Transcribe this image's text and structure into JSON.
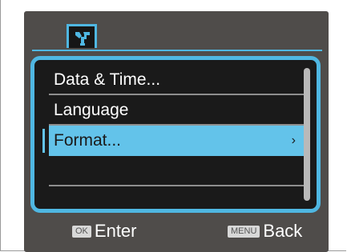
{
  "menu": {
    "tab_icon": "wrench-icon",
    "items": [
      {
        "label": "Data & Time..."
      },
      {
        "label": "Language"
      },
      {
        "label": "Format...",
        "selected": true,
        "chevron": "›"
      },
      {
        "label": ""
      },
      {
        "label": ""
      }
    ]
  },
  "footer": {
    "ok_key": "OK",
    "ok_label": "Enter",
    "menu_key": "MENU",
    "menu_label": "Back"
  },
  "colors": {
    "accent": "#4fb7e2",
    "highlight": "#63c3ea",
    "screen_bg": "#4f4c4a",
    "menu_bg": "#1a1a1a"
  }
}
